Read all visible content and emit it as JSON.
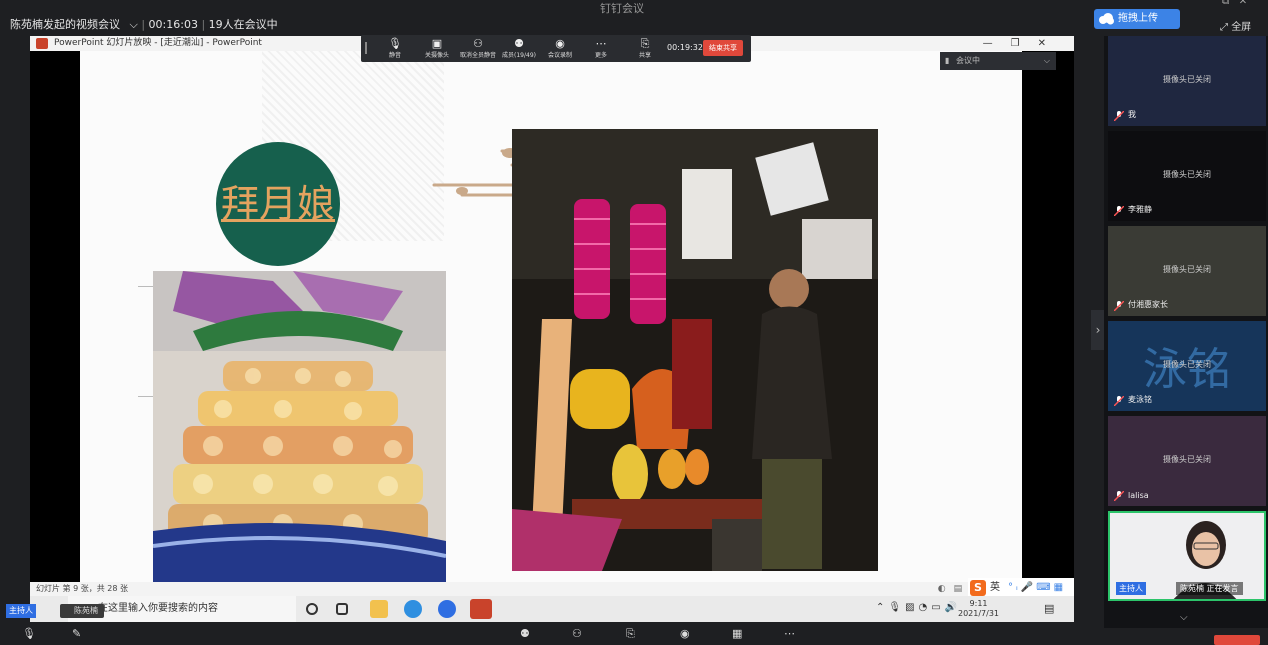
{
  "window_title": "钉钉会议",
  "meeting": {
    "title": "陈苑楠发起的视频会议",
    "elapsed": "00:16:03",
    "attendance": "19人在会议中",
    "upload_label": "拖拽上传",
    "fullscreen_label": "全屏",
    "status": "会议中"
  },
  "ppt": {
    "titlebar": "PowerPoint 幻灯片放映 - [走近潮汕] - PowerPoint",
    "slide_title": "拜月娘",
    "status_left": "幻灯片 第 9 张，共 28 张"
  },
  "toolbar": {
    "items": [
      {
        "label": "静音",
        "icon": "mic-icon"
      },
      {
        "label": "关摄像头",
        "icon": "camera-icon"
      },
      {
        "label": "取消全员静音",
        "icon": "mute-all-icon"
      },
      {
        "label": "成员(19/49)",
        "icon": "members-icon"
      },
      {
        "label": "会议录制",
        "icon": "record-icon"
      },
      {
        "label": "更多",
        "icon": "more-icon"
      },
      {
        "label": "共享",
        "icon": "share-icon"
      }
    ],
    "timer": "00:19:32",
    "end_share": "结束共享"
  },
  "taskbar": {
    "search_placeholder": "在这里输入你要搜索的内容",
    "time": "9:11",
    "date": "2021/7/31",
    "ime_lang": "英"
  },
  "host": {
    "tag": "主持人",
    "name": "陈苑楠"
  },
  "participants": [
    {
      "name": "我",
      "status": "摄像头已关闭",
      "bg": "#1f2740"
    },
    {
      "name": "李雅静",
      "status": "摄像头已关闭",
      "bg": "#0d0d10"
    },
    {
      "name": "付湘惠家长",
      "status": "摄像头已关闭",
      "bg": "#3a3b35"
    },
    {
      "name": "麦泳铭",
      "status": "摄像头已关闭",
      "bg": "#16355a",
      "avatar_text": "泳铭"
    },
    {
      "name": "lalisa",
      "status": "摄像头已关闭",
      "bg": "#3a2a3e"
    },
    {
      "name": "陈苑楠",
      "status": "正在发言",
      "host_tag": "主持人"
    }
  ],
  "colors": {
    "accent": "#3c83e6",
    "end": "#e0483b",
    "active_speaker": "#2cc46a",
    "circle": "#16604d",
    "title_text": "#e4a35f"
  }
}
